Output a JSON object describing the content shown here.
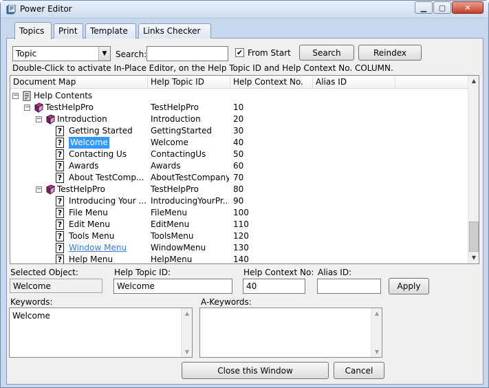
{
  "window": {
    "title": "Power Editor"
  },
  "tabs": [
    {
      "label": "Topics",
      "active": true
    },
    {
      "label": "Print"
    },
    {
      "label": "Template"
    },
    {
      "label": "Links Checker"
    }
  ],
  "search_bar": {
    "type_value": "Topic",
    "search_label": "Search:",
    "search_value": "",
    "from_start_label": "From Start",
    "from_start_checked": true,
    "search_button": "Search",
    "reindex_button": "Reindex"
  },
  "hint": "Double-Click to activate In-Place Editor, on the Help Topic ID and Help Context No. COLUMN.",
  "grid": {
    "columns": [
      "Document Map",
      "Help Topic ID",
      "Help Context No.",
      "Alias ID"
    ],
    "rows": [
      {
        "level": 0,
        "icon": "contents",
        "toggle": "−",
        "label": "Help Contents",
        "topic_id": "",
        "context": ""
      },
      {
        "level": 1,
        "icon": "book",
        "toggle": "−",
        "label": "TestHelpPro",
        "topic_id": "TestHelpPro",
        "context": "10"
      },
      {
        "level": 2,
        "icon": "book",
        "toggle": "−",
        "label": "Introduction",
        "topic_id": "Introduction",
        "context": "20"
      },
      {
        "level": 3,
        "icon": "topic",
        "label": "Getting Started",
        "topic_id": "GettingStarted",
        "context": "30"
      },
      {
        "level": 3,
        "icon": "topic",
        "label": "Welcome",
        "topic_id": "Welcome",
        "context": "40",
        "selected": true
      },
      {
        "level": 3,
        "icon": "topic",
        "label": "Contacting Us",
        "topic_id": "ContactingUs",
        "context": "50"
      },
      {
        "level": 3,
        "icon": "topic",
        "label": "Awards",
        "topic_id": "Awards",
        "context": "60"
      },
      {
        "level": 3,
        "icon": "topic",
        "label": "About TestComp...",
        "topic_id": "AboutTestCompany",
        "context": "70"
      },
      {
        "level": 2,
        "icon": "book",
        "toggle": "−",
        "label": "TestHelpPro",
        "topic_id": "TestHelpPro",
        "context": "80"
      },
      {
        "level": 3,
        "icon": "topic",
        "label": "Introducing Your ...",
        "topic_id": "IntroducingYourPr...",
        "context": "90"
      },
      {
        "level": 3,
        "icon": "topic",
        "label": "File Menu",
        "topic_id": "FileMenu",
        "context": "100"
      },
      {
        "level": 3,
        "icon": "topic",
        "label": "Edit Menu",
        "topic_id": "EditMenu",
        "context": "110"
      },
      {
        "level": 3,
        "icon": "topic",
        "label": "Tools Menu",
        "topic_id": "ToolsMenu",
        "context": "120"
      },
      {
        "level": 3,
        "icon": "topic",
        "label": "Window Menu",
        "topic_id": "WindowMenu",
        "context": "130",
        "link": true
      },
      {
        "level": 3,
        "icon": "topic",
        "label": "Help Menu",
        "topic_id": "HelpMenu",
        "context": "140"
      }
    ]
  },
  "details": {
    "selected_object_label": "Selected Object:",
    "selected_object_value": "Welcome",
    "topic_id_label": "Help Topic ID:",
    "topic_id_value": "Welcome",
    "context_no_label": "Help Context No:",
    "context_no_value": "40",
    "alias_label": "Alias ID:",
    "alias_value": "",
    "apply_button": "Apply"
  },
  "keywords": {
    "label": "Keywords:",
    "value": "Welcome"
  },
  "a_keywords": {
    "label": "A-Keywords:",
    "value": ""
  },
  "footer": {
    "close_button": "Close this Window",
    "cancel_button": "Cancel"
  }
}
